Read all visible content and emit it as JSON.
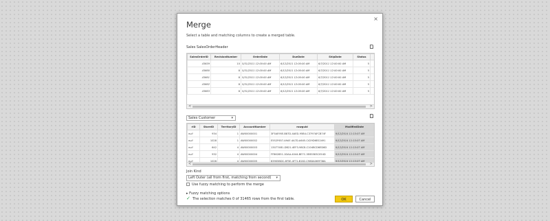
{
  "dialog": {
    "title": "Merge",
    "close_glyph": "×",
    "subtitle": "Select a table and matching columns to create a merged table."
  },
  "table1": {
    "name": "Sales SalesOrderHeader",
    "columns": [
      "SalesOrderID",
      "RevisionNumber",
      "OrderDate",
      "DueDate",
      "ShipDate",
      "Status",
      "O"
    ],
    "rows": [
      [
        "43659",
        "10",
        "5/31/2011 12:00:00 AM",
        "6/12/2011 12:00:00 AM",
        "6/7/2011 12:00:00 AM",
        "5",
        ""
      ],
      [
        "43660",
        "8",
        "5/31/2011 12:00:00 AM",
        "6/12/2011 12:00:00 AM",
        "6/7/2011 12:00:00 AM",
        "5",
        ""
      ],
      [
        "43661",
        "8",
        "5/31/2011 12:00:00 AM",
        "6/12/2011 12:00:00 AM",
        "6/7/2011 12:00:00 AM",
        "5",
        ""
      ],
      [
        "43662",
        "8",
        "5/31/2011 12:00:00 AM",
        "6/12/2011 12:00:00 AM",
        "6/7/2011 12:00:00 AM",
        "5",
        ""
      ],
      [
        "43663",
        "8",
        "5/31/2011 12:00:00 AM",
        "6/12/2011 12:00:00 AM",
        "6/7/2011 12:00:00 AM",
        "5",
        ""
      ]
    ],
    "scroll_left": "<",
    "scroll_right": ">"
  },
  "table2": {
    "selected": "Sales Customer",
    "caret": "▾",
    "columns": [
      "rID",
      "StoreID",
      "TerritoryID",
      "AccountNumber",
      "rowguid",
      "ModifiedDate"
    ],
    "rows": [
      [
        "null",
        "934",
        "1",
        "AW00000001",
        "3F5AE95E-B87D-4AED-95B4-C3797AFCB74F",
        "9/12/2014 11:15:07 AM"
      ],
      [
        "null",
        "1028",
        "1",
        "AW00000002",
        "E552F657-A9AF-4A7D-A645-C429D6E02491",
        "9/12/2014 11:15:07 AM"
      ],
      [
        "null",
        "642",
        "4",
        "AW00000003",
        "130774B1-DB21-4EF3-98C8-C104BCD6ED6D",
        "9/12/2014 11:15:07 AM"
      ],
      [
        "null",
        "932",
        "4",
        "AW00000004",
        "FF862851-1DAA-4044-BE7C-3E85583C054D",
        "9/12/2014 11:15:07 AM"
      ],
      [
        "null",
        "1026",
        "4",
        "AW00000005",
        "83905BDC-6F5E-4F71-B162-C98DA069F38A",
        "9/12/2014 11:15:07 AM"
      ]
    ],
    "scroll_left": "<",
    "scroll_right": ">"
  },
  "join": {
    "label": "Join Kind",
    "selected": "Left Outer (all from first, matching from second)",
    "caret": "▾",
    "fuzzy_checkbox_label": "Use fuzzy matching to perform the merge",
    "fuzzy_options_caret": "▸",
    "fuzzy_options_label": "Fuzzy matching options"
  },
  "status": {
    "check_glyph": "✓",
    "text": "The selection matches 0 of 31465 rows from the first table."
  },
  "buttons": {
    "ok": "OK",
    "cancel": "Cancel"
  },
  "colors": {
    "ok_button": "#f2c811",
    "success_check": "#2e9e50",
    "selected_column": "#d9d9d9"
  }
}
